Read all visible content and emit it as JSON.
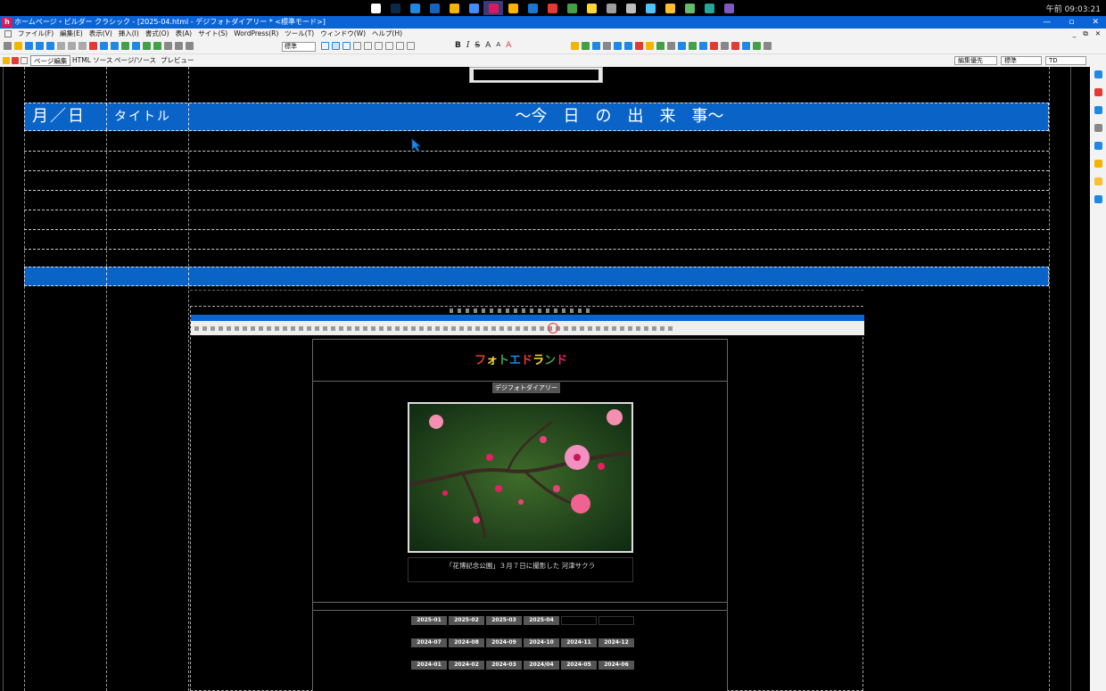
{
  "taskbar": {
    "clock": "午前 09:03:21",
    "icons": [
      {
        "name": "windows-start-icon",
        "color": "#ffffff"
      },
      {
        "name": "photoshop-icon",
        "color": "#0b2a4a"
      },
      {
        "name": "photoshop-express-icon",
        "color": "#1e88e5"
      },
      {
        "name": "lightroom-icon",
        "color": "#1565c0"
      },
      {
        "name": "folder-icon",
        "color": "#f4b400"
      },
      {
        "name": "app-blue-icon",
        "color": "#3f8efc"
      },
      {
        "name": "homepage-builder-icon",
        "color": "#d81b60"
      },
      {
        "name": "sun-app-icon",
        "color": "#ffb300"
      },
      {
        "name": "edge-icon",
        "color": "#1976d2"
      },
      {
        "name": "chrome-icon",
        "color": "#e53935"
      },
      {
        "name": "sheet-icon",
        "color": "#43a047"
      },
      {
        "name": "yellow-app-icon",
        "color": "#fdd835"
      },
      {
        "name": "clock-app-icon",
        "color": "#9e9e9e"
      },
      {
        "name": "gear-app-icon",
        "color": "#bdbdbd"
      },
      {
        "name": "notes-icon",
        "color": "#4fc3f7"
      },
      {
        "name": "sticky-note-icon",
        "color": "#fbc02d"
      },
      {
        "name": "b-app-icon",
        "color": "#66bb6a"
      },
      {
        "name": "teal-app-icon",
        "color": "#26a69a"
      },
      {
        "name": "purple-app-icon",
        "color": "#7e57c2"
      }
    ]
  },
  "titlebar": {
    "logo": "h",
    "title": "ホームページ・ビルダー クラシック - [2025-04.html - デジフォトダイアリー * <標準モード>]",
    "minimize": "—",
    "maximize": "▫",
    "close": "✕"
  },
  "menubar": {
    "items": [
      "ファイル(F)",
      "編集(E)",
      "表示(V)",
      "挿入(I)",
      "書式(O)",
      "表(A)",
      "サイト(S)",
      "WordPress(R)",
      "ツール(T)",
      "ウィンドウ(W)",
      "ヘルプ(H)"
    ],
    "right": [
      "_",
      "⧉",
      "✕"
    ]
  },
  "toolbar": {
    "style_select": "標準",
    "icon_colors": [
      "#888",
      "#f4b400",
      "#1e88e5",
      "#1e88e5",
      "#1e88e5",
      "#aaa",
      "#aaa",
      "#aaa",
      "#e53935",
      "#1e88e5",
      "#1e88e5",
      "#43a047",
      "#1e88e5",
      "#43a047",
      "#43a047",
      "#888",
      "#888",
      "#888"
    ],
    "format_buttons": [
      "B",
      "I",
      "S",
      "A",
      "A",
      "A"
    ],
    "icon_colors_right": [
      "#f4b400",
      "#43a047",
      "#1e88e5",
      "#888",
      "#1e88e5",
      "#1e88e5",
      "#e53935",
      "#f4b400",
      "#43a047",
      "#888",
      "#1e88e5",
      "#43a047",
      "#1e88e5",
      "#e53935",
      "#888",
      "#e53935",
      "#1e88e5",
      "#43a047",
      "#888"
    ]
  },
  "tabs": {
    "page_edit": "ページ編集",
    "html_source": "HTML ソース",
    "page_source": "ページ/ソース",
    "preview": "プレビュー",
    "edit_priority": "編集優先",
    "style": "標準",
    "tag": "TD"
  },
  "right_panel": {
    "icon_colors": [
      "#1e88e5",
      "#e53935",
      "#1e88e5",
      "#888",
      "#1e88e5",
      "#f4b400",
      "#fbc02d",
      "#1e88e5"
    ]
  },
  "diary_table": {
    "col_date": "月／日",
    "col_title": "タイトル",
    "col_events": "～今　日　の　出　来　事～"
  },
  "inner_screenshot": {
    "logo_text": "フォトエドランド",
    "logo_colors": [
      "#e53935",
      "#fdd835",
      "#43a047",
      "#1e88e5",
      "#e53935",
      "#fdd835",
      "#43a047",
      "#e91e63"
    ],
    "subtitle": "デジフォトダイアリー",
    "photo_caption": "「花博記念公園」３月７日に撮影した 河津サクラ",
    "archive_rows": [
      [
        "2025-01",
        "2025-02",
        "2025-03",
        "2025-04",
        "",
        ""
      ],
      [
        "2024-07",
        "2024-08",
        "2024-09",
        "2024-10",
        "2024-11",
        "2024-12"
      ],
      [
        "2024-01",
        "2024-02",
        "2024-03",
        "2024/04",
        "2024-05",
        "2024-06"
      ]
    ]
  }
}
